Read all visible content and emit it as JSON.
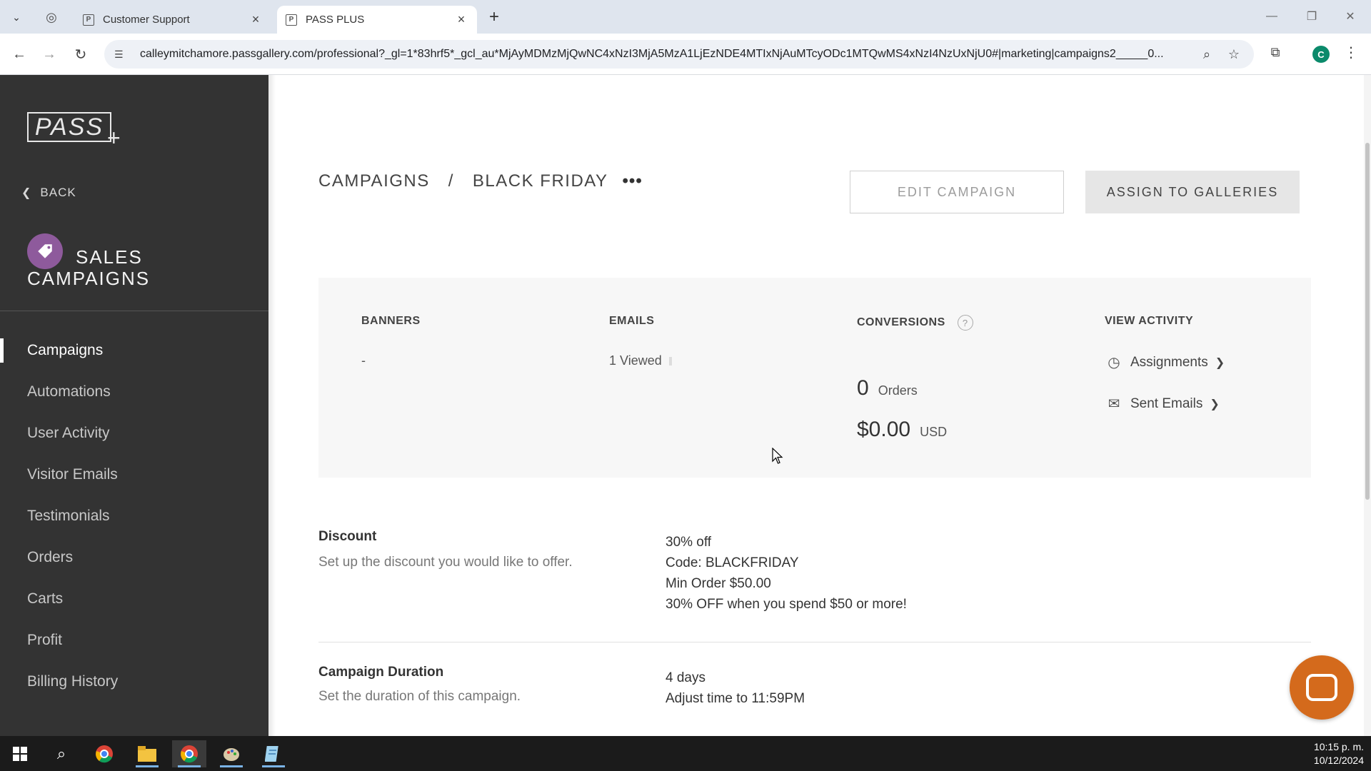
{
  "browser": {
    "tabs": [
      {
        "title": "Customer Support",
        "favicon": "P"
      },
      {
        "title": "PASS PLUS",
        "favicon": "P"
      }
    ],
    "url": "calleymitchamore.passgallery.com/professional?_gl=1*83hrf5*_gcl_au*MjAyMDMzMjQwNC4xNzI3MjA5MzA1LjEzNDE4MTIxNjAuMTcyODc1MTQwMS4xNzI4NzUxNjU0#|marketing|campaigns2_____0...",
    "profile_initial": "C"
  },
  "sidebar": {
    "logo_text": "PASS",
    "logo_plus": "+",
    "back_label": "BACK",
    "section_title_line1": "SALES",
    "section_title_line2": "CAMPAIGNS",
    "items": [
      {
        "label": "Campaigns",
        "active": true
      },
      {
        "label": "Automations"
      },
      {
        "label": "User Activity"
      },
      {
        "label": "Visitor Emails"
      },
      {
        "label": "Testimonials"
      },
      {
        "label": "Orders"
      },
      {
        "label": "Carts"
      },
      {
        "label": "Profit"
      },
      {
        "label": "Billing History"
      }
    ]
  },
  "header": {
    "crumb_root": "CAMPAIGNS",
    "crumb_sep": "/",
    "crumb_current": "BLACK FRIDAY",
    "more": "•••",
    "edit_label": "EDIT CAMPAIGN",
    "assign_label": "ASSIGN TO GALLERIES"
  },
  "stats": {
    "banners_label": "BANNERS",
    "banners_value": "-",
    "emails_label": "EMAILS",
    "emails_value": "1 Viewed",
    "conversions_label": "CONVERSIONS",
    "orders_count": "0",
    "orders_label": "Orders",
    "revenue": "$0.00",
    "currency": "USD",
    "activity_label": "VIEW ACTIVITY",
    "assignments_label": "Assignments",
    "sent_emails_label": "Sent Emails"
  },
  "discount": {
    "title": "Discount",
    "description": "Set up the discount you would like to offer.",
    "lines": [
      "30% off",
      "Code: BLACKFRIDAY",
      "Min Order $50.00",
      "30% OFF when you spend $50 or more!"
    ]
  },
  "duration": {
    "title": "Campaign Duration",
    "description": "Set the duration of this campaign.",
    "lines": [
      "4 days",
      "Adjust time to 11:59PM"
    ]
  },
  "taskbar": {
    "time": "10:15 p. m.",
    "date": "10/12/2024"
  },
  "colors": {
    "sidebar_bg": "#333333",
    "tag_icon": "#8e5a9c",
    "chat_button": "#d46a1c"
  }
}
